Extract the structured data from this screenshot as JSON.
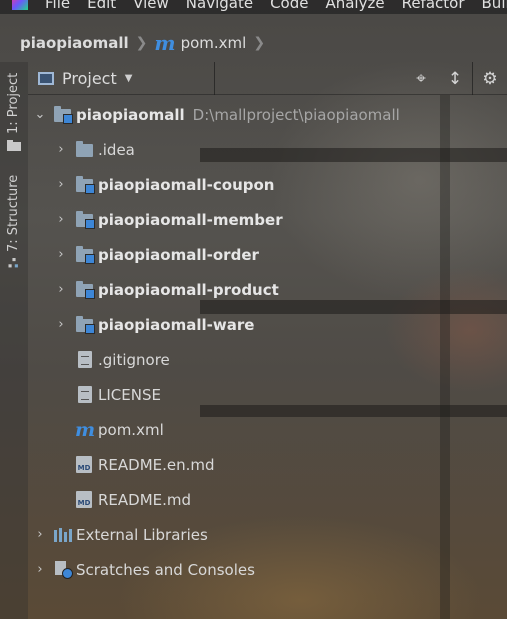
{
  "menu": [
    "File",
    "Edit",
    "View",
    "Navigate",
    "Code",
    "Analyze",
    "Refactor",
    "Build"
  ],
  "breadcrumb": {
    "project": "piaopiaomall",
    "file": "pom.xml",
    "file_icon": "m"
  },
  "left_tool_tabs": {
    "project": "1: Project",
    "structure": "7: Structure"
  },
  "panel": {
    "title": "Project"
  },
  "tree": {
    "root": {
      "name": "piaopiaomall",
      "path": "D:\\mallproject\\piaopiaomall"
    },
    "folders": [
      ".idea"
    ],
    "modules": [
      "piaopiaomall-coupon",
      "piaopiaomall-member",
      "piaopiaomall-order",
      "piaopiaomall-product",
      "piaopiaomall-ware"
    ],
    "files": {
      "gitignore": ".gitignore",
      "license": "LICENSE",
      "pom": "pom.xml",
      "readme_en": "README.en.md",
      "readme": "README.md"
    },
    "external_libraries": "External Libraries",
    "scratches": "Scratches and Consoles"
  },
  "icons": {
    "md_badge": "MD"
  },
  "colors": {
    "accent": "#3d86d6",
    "maven": "#3f8ee0"
  }
}
